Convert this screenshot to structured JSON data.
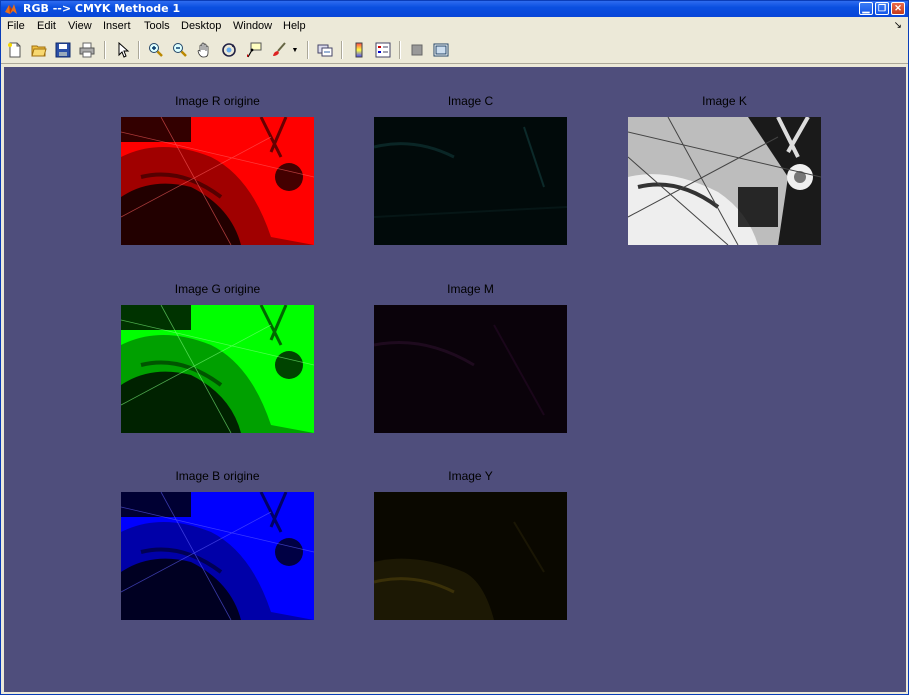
{
  "window": {
    "title": "RGB --> CMYK Methode 1",
    "buttons": [
      "minimize",
      "maximize",
      "close"
    ]
  },
  "menubar": {
    "items": [
      "File",
      "Edit",
      "View",
      "Insert",
      "Tools",
      "Desktop",
      "Window",
      "Help"
    ]
  },
  "toolbar": {
    "tools": [
      "new-figure-icon",
      "open-file-icon",
      "save-icon",
      "print-icon",
      "edit-plot-icon",
      "zoom-in-icon",
      "zoom-out-icon",
      "pan-icon",
      "rotate-3d-icon",
      "data-cursor-icon",
      "brush-icon",
      "brush-dropdown-icon",
      "link-plot-icon",
      "colorbar-icon",
      "legend-icon",
      "hide-plot-tools-icon",
      "show-plot-tools-icon"
    ]
  },
  "colors": {
    "figure_background": "#4f4e7c",
    "red": "#ff0000",
    "green": "#00ff00",
    "blue": "#0000ff"
  },
  "axes": {
    "r": {
      "title": "Image R origine"
    },
    "g": {
      "title": "Image G origine"
    },
    "b": {
      "title": "Image B origine"
    },
    "c": {
      "title": "Image C"
    },
    "m": {
      "title": "Image M"
    },
    "y": {
      "title": "Image Y"
    },
    "k": {
      "title": "Image K"
    }
  }
}
